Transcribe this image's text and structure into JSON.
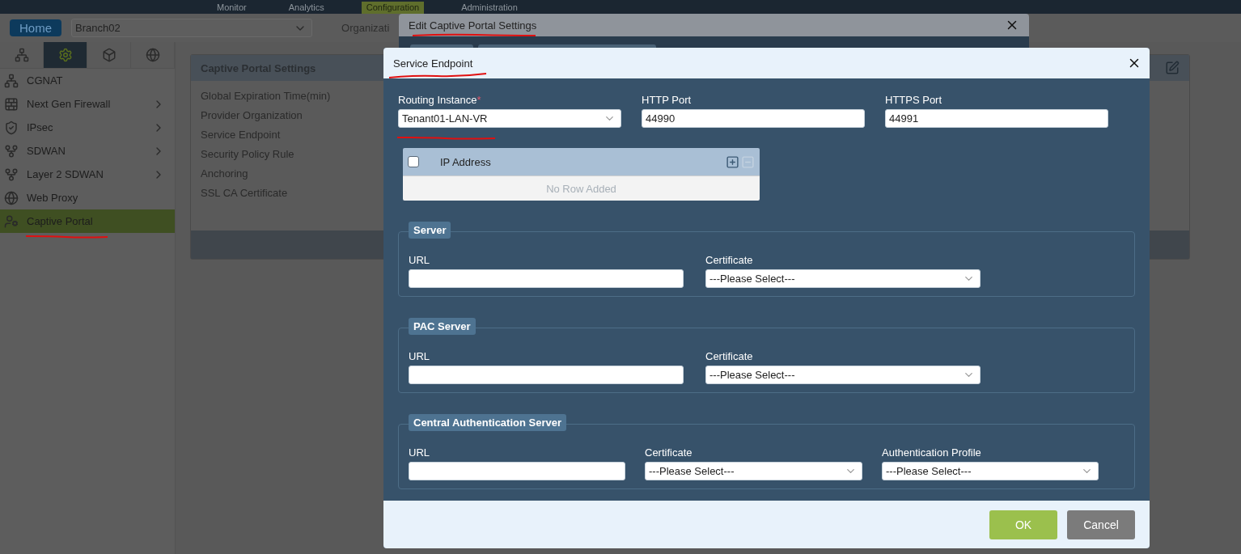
{
  "top_nav": [
    {
      "label": "Monitor",
      "selected": false
    },
    {
      "label": "Analytics",
      "selected": false
    },
    {
      "label": "Configuration",
      "selected": true
    },
    {
      "label": "Administration",
      "selected": false
    }
  ],
  "toolbar": {
    "home_button": "Home",
    "branch_select": "Branch02",
    "organization_label": "Organizati"
  },
  "sidebar": {
    "tabs": [
      {
        "kind": "network",
        "selected": false
      },
      {
        "kind": "settings",
        "selected": true
      },
      {
        "kind": "box",
        "selected": false
      },
      {
        "kind": "globe",
        "selected": false
      }
    ],
    "items": [
      {
        "label": "CGNAT",
        "kind": "network",
        "expandable": false,
        "selected": false
      },
      {
        "label": "Next Gen Firewall",
        "kind": "firewall",
        "expandable": true,
        "selected": false
      },
      {
        "label": "IPsec",
        "kind": "shield",
        "expandable": true,
        "selected": false
      },
      {
        "label": "SDWAN",
        "kind": "fork",
        "expandable": true,
        "selected": false
      },
      {
        "label": "Layer 2 SDWAN",
        "kind": "fork",
        "expandable": true,
        "selected": false
      },
      {
        "label": "Web Proxy",
        "kind": "globe",
        "expandable": false,
        "selected": false
      },
      {
        "label": "Captive Portal",
        "kind": "user",
        "expandable": false,
        "selected": true
      }
    ]
  },
  "settings_card": {
    "title": "Captive Portal Settings",
    "fields": [
      "Global Expiration Time(min)",
      "Provider Organization",
      "Service Endpoint",
      "Security Policy Rule",
      "Anchoring",
      "SSL CA Certificate"
    ]
  },
  "back_dialog": {
    "title": "Edit Captive Portal Settings"
  },
  "dialog": {
    "title": "Service Endpoint",
    "top_fields": [
      {
        "kind": "select",
        "label": "Routing Instance",
        "required_mark": "*",
        "value": "Tenant01-LAN-VR"
      },
      {
        "kind": "input",
        "label": "HTTP Port",
        "value": "44990"
      },
      {
        "kind": "input",
        "label": "HTTPS Port",
        "value": "44991"
      }
    ],
    "ip_table": {
      "column": "IP Address",
      "checked": false,
      "empty_text": "No Row Added"
    },
    "sections": [
      {
        "legend": "Server",
        "fields": [
          {
            "kind": "input",
            "label": "URL"
          },
          {
            "kind": "select",
            "label": "Certificate",
            "value": "---Please Select---"
          }
        ]
      },
      {
        "legend": "PAC Server",
        "fields": [
          {
            "kind": "input",
            "label": "URL"
          },
          {
            "kind": "select",
            "label": "Certificate",
            "value": "---Please Select---"
          }
        ]
      },
      {
        "legend": "Central Authentication Server",
        "fields": [
          {
            "kind": "input",
            "label": "URL"
          },
          {
            "kind": "select",
            "label": "Certificate",
            "value": "---Please Select---"
          },
          {
            "kind": "select",
            "label": "Authentication Profile",
            "value": "---Please Select---"
          }
        ]
      }
    ],
    "buttons": [
      {
        "label": "OK",
        "kind": "primary"
      },
      {
        "label": "Cancel",
        "kind": "secondary"
      }
    ]
  }
}
